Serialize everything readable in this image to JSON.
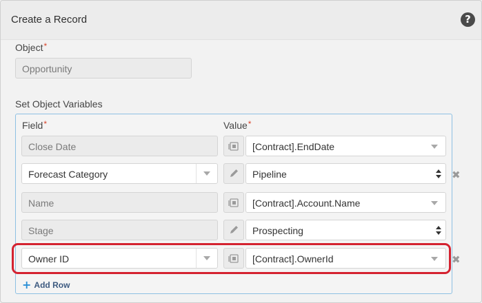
{
  "header": {
    "title": "Create a Record",
    "help_icon": "?"
  },
  "object": {
    "label": "Object",
    "required_mark": "*",
    "value": "Opportunity"
  },
  "section": {
    "label": "Set Object Variables"
  },
  "columns": {
    "field_label": "Field",
    "value_label": "Value",
    "required_mark": "*"
  },
  "rows": [
    {
      "field": "Close Date",
      "field_editable": false,
      "value_icon": "merge-field-icon",
      "value": "[Contract].EndDate",
      "value_control": "dropdown",
      "removable": false
    },
    {
      "field": "Forecast Category",
      "field_editable": true,
      "value_icon": "pencil-icon",
      "value": "Pipeline",
      "value_control": "select",
      "removable": true
    },
    {
      "field": "Name",
      "field_editable": false,
      "value_icon": "merge-field-icon",
      "value": "[Contract].Account.Name",
      "value_control": "dropdown",
      "removable": false
    },
    {
      "field": "Stage",
      "field_editable": false,
      "value_icon": "pencil-icon",
      "value": "Prospecting",
      "value_control": "select",
      "removable": false
    },
    {
      "field": "Owner ID",
      "field_editable": true,
      "value_icon": "merge-field-icon",
      "value": "[Contract].OwnerId",
      "value_control": "dropdown",
      "removable": true,
      "highlighted": true
    }
  ],
  "remove_glyph": "✖",
  "add_row": {
    "label": "Add Row",
    "icon": "+"
  },
  "colors": {
    "highlight": "#d42230",
    "section_border": "#8dc0e3",
    "add_icon": "#2a8fd6",
    "required": "#d9442b"
  }
}
